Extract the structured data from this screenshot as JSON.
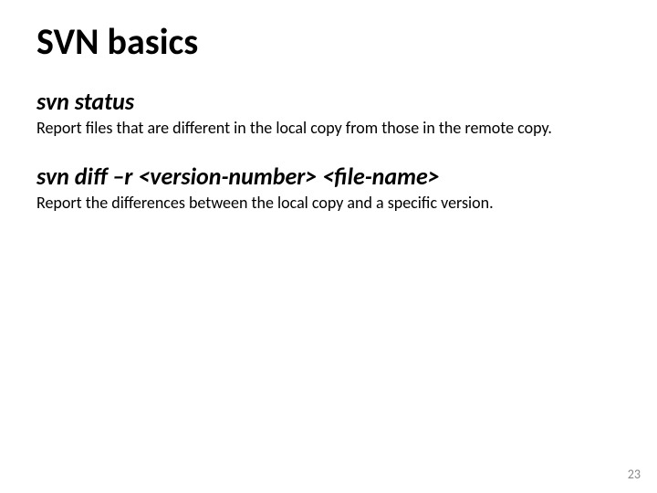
{
  "title": "SVN basics",
  "sections": [
    {
      "command": "svn status",
      "description": "Report files that are different in the local copy from those in the remote copy."
    },
    {
      "command": "svn diff –r <version-number> <file-name>",
      "description": "Report the differences between the local copy and a specific version."
    }
  ],
  "page_number": "23"
}
